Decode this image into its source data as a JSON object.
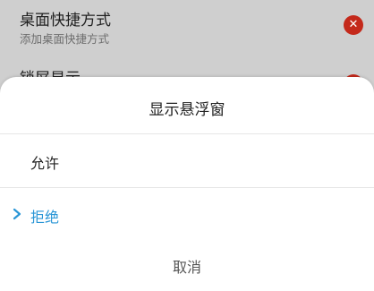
{
  "background": {
    "items": [
      {
        "title": "桌面快捷方式",
        "subtitle": "添加桌面快捷方式",
        "toggle_icon": "close-icon"
      },
      {
        "title": "锁屏显示",
        "toggle_icon": "close-icon"
      }
    ]
  },
  "dialog": {
    "title": "显示悬浮窗",
    "options": [
      {
        "label": "允许",
        "selected": false
      },
      {
        "label": "拒绝",
        "selected": true
      }
    ],
    "cancel_label": "取消"
  },
  "colors": {
    "accent": "#2a96d6",
    "toggle_off": "#c4291b",
    "scrim_background": "#cfcfcf",
    "sheet_background": "#ffffff"
  }
}
